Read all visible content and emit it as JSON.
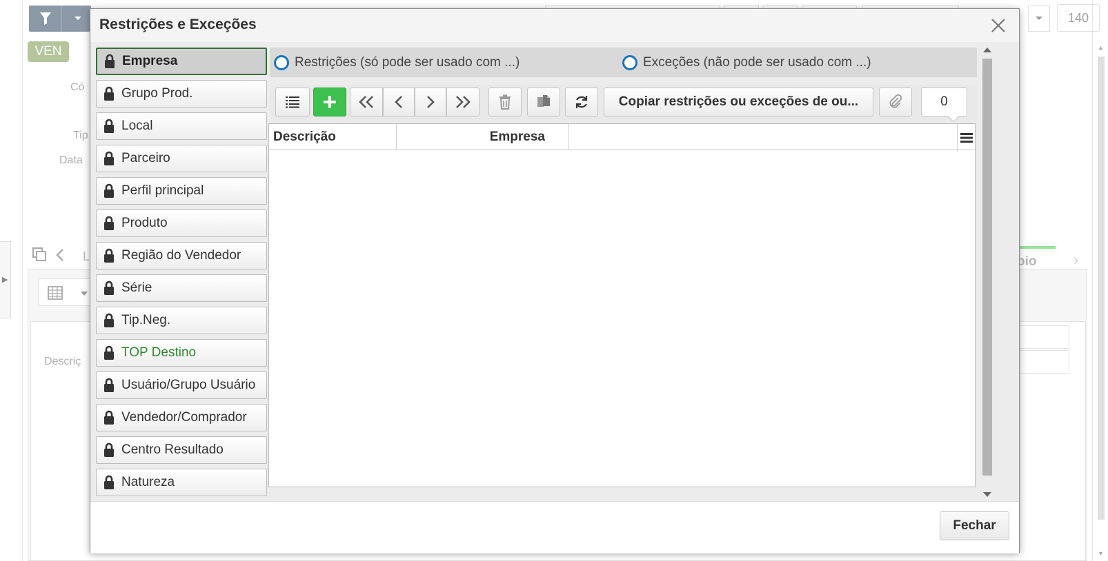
{
  "background": {
    "badge": "VEN",
    "count_field": "140",
    "labels": [
      "Có",
      "Tip",
      "Data",
      "Descriç",
      "L"
    ],
    "tab_partial": "pio"
  },
  "modal": {
    "title": "Restrições e Exceções",
    "categories": [
      {
        "label": "Empresa",
        "state": "active"
      },
      {
        "label": "Grupo Prod.",
        "state": "normal"
      },
      {
        "label": "Local",
        "state": "normal"
      },
      {
        "label": "Parceiro",
        "state": "normal"
      },
      {
        "label": "Perfil principal",
        "state": "normal"
      },
      {
        "label": "Produto",
        "state": "normal"
      },
      {
        "label": "Região do Vendedor",
        "state": "normal"
      },
      {
        "label": "Série",
        "state": "normal"
      },
      {
        "label": "Tip.Neg.",
        "state": "normal"
      },
      {
        "label": "TOP Destino",
        "state": "highlight"
      },
      {
        "label": "Usuário/Grupo Usuário",
        "state": "normal"
      },
      {
        "label": "Vendedor/Comprador",
        "state": "normal"
      },
      {
        "label": "Centro Resultado",
        "state": "normal"
      },
      {
        "label": "Natureza",
        "state": "normal"
      }
    ],
    "radios": {
      "restricoes": "Restrições (só pode ser usado com ...)",
      "excecoes": "Exceções (não pode ser usado com ...)"
    },
    "toolbar": {
      "copy_label": "Copiar restrições ou exceções de ou...",
      "counter": "0",
      "icons": [
        "list-icon",
        "plus-icon",
        "first-page-icon",
        "prev-icon",
        "next-icon",
        "last-page-icon",
        "trash-icon",
        "copy-icon",
        "refresh-icon",
        "paperclip-icon"
      ]
    },
    "grid": {
      "columns": [
        "Descrição",
        "Empresa"
      ],
      "rows": []
    },
    "footer": {
      "close_label": "Fechar"
    }
  },
  "colors": {
    "accent_green": "#3cc14f",
    "highlight_text": "#2e8b2e",
    "radio_blue": "#1e73be",
    "active_border": "#3a6b3a"
  }
}
